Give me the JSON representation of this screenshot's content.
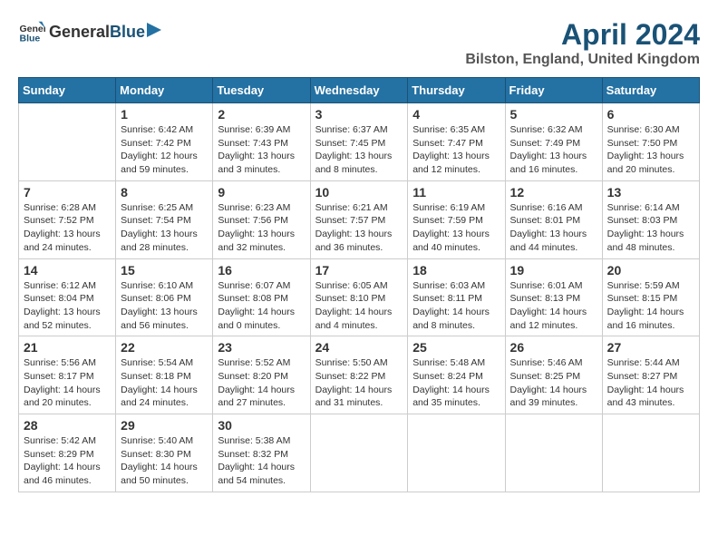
{
  "header": {
    "logo_general": "General",
    "logo_blue": "Blue",
    "month_year": "April 2024",
    "location": "Bilston, England, United Kingdom"
  },
  "weekdays": [
    "Sunday",
    "Monday",
    "Tuesday",
    "Wednesday",
    "Thursday",
    "Friday",
    "Saturday"
  ],
  "weeks": [
    [
      {
        "day": "",
        "info": ""
      },
      {
        "day": "1",
        "info": "Sunrise: 6:42 AM\nSunset: 7:42 PM\nDaylight: 12 hours\nand 59 minutes."
      },
      {
        "day": "2",
        "info": "Sunrise: 6:39 AM\nSunset: 7:43 PM\nDaylight: 13 hours\nand 3 minutes."
      },
      {
        "day": "3",
        "info": "Sunrise: 6:37 AM\nSunset: 7:45 PM\nDaylight: 13 hours\nand 8 minutes."
      },
      {
        "day": "4",
        "info": "Sunrise: 6:35 AM\nSunset: 7:47 PM\nDaylight: 13 hours\nand 12 minutes."
      },
      {
        "day": "5",
        "info": "Sunrise: 6:32 AM\nSunset: 7:49 PM\nDaylight: 13 hours\nand 16 minutes."
      },
      {
        "day": "6",
        "info": "Sunrise: 6:30 AM\nSunset: 7:50 PM\nDaylight: 13 hours\nand 20 minutes."
      }
    ],
    [
      {
        "day": "7",
        "info": "Sunrise: 6:28 AM\nSunset: 7:52 PM\nDaylight: 13 hours\nand 24 minutes."
      },
      {
        "day": "8",
        "info": "Sunrise: 6:25 AM\nSunset: 7:54 PM\nDaylight: 13 hours\nand 28 minutes."
      },
      {
        "day": "9",
        "info": "Sunrise: 6:23 AM\nSunset: 7:56 PM\nDaylight: 13 hours\nand 32 minutes."
      },
      {
        "day": "10",
        "info": "Sunrise: 6:21 AM\nSunset: 7:57 PM\nDaylight: 13 hours\nand 36 minutes."
      },
      {
        "day": "11",
        "info": "Sunrise: 6:19 AM\nSunset: 7:59 PM\nDaylight: 13 hours\nand 40 minutes."
      },
      {
        "day": "12",
        "info": "Sunrise: 6:16 AM\nSunset: 8:01 PM\nDaylight: 13 hours\nand 44 minutes."
      },
      {
        "day": "13",
        "info": "Sunrise: 6:14 AM\nSunset: 8:03 PM\nDaylight: 13 hours\nand 48 minutes."
      }
    ],
    [
      {
        "day": "14",
        "info": "Sunrise: 6:12 AM\nSunset: 8:04 PM\nDaylight: 13 hours\nand 52 minutes."
      },
      {
        "day": "15",
        "info": "Sunrise: 6:10 AM\nSunset: 8:06 PM\nDaylight: 13 hours\nand 56 minutes."
      },
      {
        "day": "16",
        "info": "Sunrise: 6:07 AM\nSunset: 8:08 PM\nDaylight: 14 hours\nand 0 minutes."
      },
      {
        "day": "17",
        "info": "Sunrise: 6:05 AM\nSunset: 8:10 PM\nDaylight: 14 hours\nand 4 minutes."
      },
      {
        "day": "18",
        "info": "Sunrise: 6:03 AM\nSunset: 8:11 PM\nDaylight: 14 hours\nand 8 minutes."
      },
      {
        "day": "19",
        "info": "Sunrise: 6:01 AM\nSunset: 8:13 PM\nDaylight: 14 hours\nand 12 minutes."
      },
      {
        "day": "20",
        "info": "Sunrise: 5:59 AM\nSunset: 8:15 PM\nDaylight: 14 hours\nand 16 minutes."
      }
    ],
    [
      {
        "day": "21",
        "info": "Sunrise: 5:56 AM\nSunset: 8:17 PM\nDaylight: 14 hours\nand 20 minutes."
      },
      {
        "day": "22",
        "info": "Sunrise: 5:54 AM\nSunset: 8:18 PM\nDaylight: 14 hours\nand 24 minutes."
      },
      {
        "day": "23",
        "info": "Sunrise: 5:52 AM\nSunset: 8:20 PM\nDaylight: 14 hours\nand 27 minutes."
      },
      {
        "day": "24",
        "info": "Sunrise: 5:50 AM\nSunset: 8:22 PM\nDaylight: 14 hours\nand 31 minutes."
      },
      {
        "day": "25",
        "info": "Sunrise: 5:48 AM\nSunset: 8:24 PM\nDaylight: 14 hours\nand 35 minutes."
      },
      {
        "day": "26",
        "info": "Sunrise: 5:46 AM\nSunset: 8:25 PM\nDaylight: 14 hours\nand 39 minutes."
      },
      {
        "day": "27",
        "info": "Sunrise: 5:44 AM\nSunset: 8:27 PM\nDaylight: 14 hours\nand 43 minutes."
      }
    ],
    [
      {
        "day": "28",
        "info": "Sunrise: 5:42 AM\nSunset: 8:29 PM\nDaylight: 14 hours\nand 46 minutes."
      },
      {
        "day": "29",
        "info": "Sunrise: 5:40 AM\nSunset: 8:30 PM\nDaylight: 14 hours\nand 50 minutes."
      },
      {
        "day": "30",
        "info": "Sunrise: 5:38 AM\nSunset: 8:32 PM\nDaylight: 14 hours\nand 54 minutes."
      },
      {
        "day": "",
        "info": ""
      },
      {
        "day": "",
        "info": ""
      },
      {
        "day": "",
        "info": ""
      },
      {
        "day": "",
        "info": ""
      }
    ]
  ]
}
